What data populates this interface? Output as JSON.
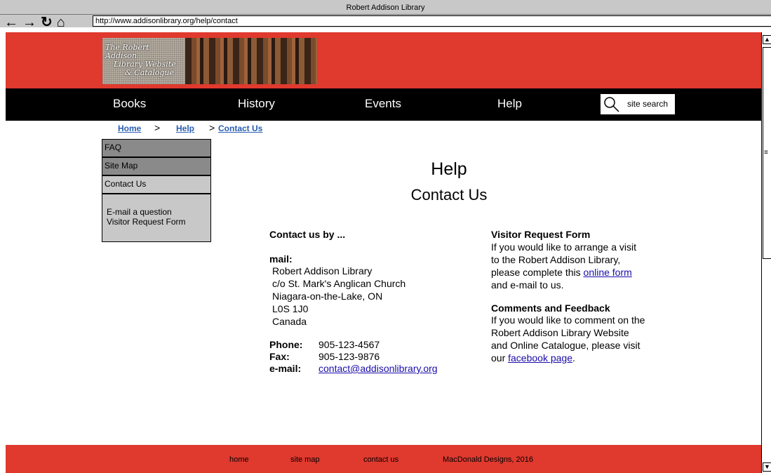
{
  "browser": {
    "window_title": "Robert Addison Library",
    "url": "http://www.addisonlibrary.org/help/contact"
  },
  "header": {
    "logo_lines": [
      "The Robert Addison",
      "Library Website",
      "& Catalogue"
    ]
  },
  "nav": {
    "items": [
      "Books",
      "History",
      "Events",
      "Help"
    ],
    "search_placeholder": "site search"
  },
  "breadcrumb": [
    "Home",
    "Help",
    "Contact Us"
  ],
  "sidebar": {
    "items": [
      "FAQ",
      "Site Map",
      "Contact Us"
    ],
    "sub_items": [
      "E-mail a question",
      "Visitor Request Form"
    ]
  },
  "main": {
    "title": "Help",
    "subtitle": "Contact Us",
    "contact_heading": "Contact us by ...",
    "mail_label": "mail:",
    "address": [
      "Robert Addison Library",
      "c/o St. Mark's Anglican Church",
      "Niagara-on-the-Lake, ON",
      "L0S 1J0",
      "Canada"
    ],
    "phone_label": "Phone:",
    "phone": "905-123-4567",
    "fax_label": "Fax:",
    "fax": "905-123-9876",
    "email_label": "e-mail:",
    "email": "contact@addisonlibrary.org",
    "visitor_heading": "Visitor Request Form",
    "visitor_lines": [
      "If you would like to arrange a visit",
      "to the Robert Addison Library,"
    ],
    "visitor_pre_link": "please complete this ",
    "visitor_link": "online form",
    "visitor_after": "and e-mail to us.",
    "feedback_heading": "Comments and Feedback",
    "feedback_lines": [
      "If you would like to comment on the",
      "Robert Addison Library Website",
      "and Online Catalogue, please visit"
    ],
    "feedback_pre_link": "our ",
    "feedback_link": "facebook page",
    "feedback_post_link": "."
  },
  "footer": {
    "links": [
      "home",
      "site map",
      "contact us"
    ],
    "credit": "MacDonald Designs, 2016"
  },
  "colors": {
    "brand_red": "#e0392e",
    "nav_black": "#000000",
    "link_blue": "#1a0dab"
  }
}
